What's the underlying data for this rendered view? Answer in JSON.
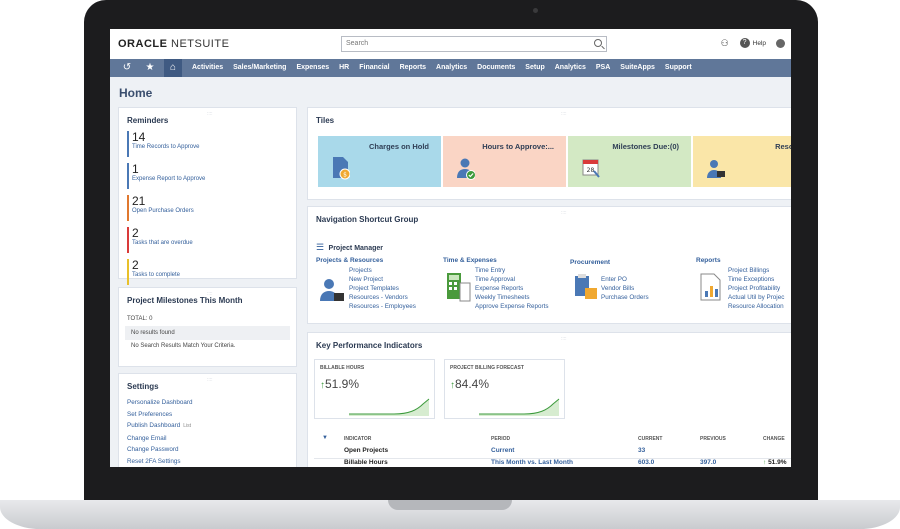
{
  "app": {
    "logo_main": "ORACLE",
    "logo_sub": "NETSUITE",
    "search_placeholder": "Search",
    "help_label": "Help"
  },
  "nav": {
    "items": [
      "Activities",
      "Sales/Marketing",
      "Expenses",
      "HR",
      "Financial",
      "Reports",
      "Analytics",
      "Documents",
      "Setup",
      "Analytics",
      "PSA",
      "SuiteApps",
      "Support"
    ]
  },
  "page": {
    "title": "Home"
  },
  "reminders": {
    "title": "Reminders",
    "items": [
      {
        "count": "14",
        "label": "Time Records to Approve",
        "color": "#4a78b5"
      },
      {
        "count": "1",
        "label": "Expense Report to Approve",
        "color": "#4a78b5"
      },
      {
        "count": "21",
        "label": "Open Purchase Orders",
        "color": "#e0782f"
      },
      {
        "count": "2",
        "label": "Tasks that are overdue",
        "color": "#d93a3a"
      },
      {
        "count": "2",
        "label": "Tasks to complete",
        "color": "#e8c02a"
      }
    ]
  },
  "milestones": {
    "title": "Project Milestones This Month",
    "total": "TOTAL: 0",
    "no_results": "No results found",
    "no_match": "No Search Results Match Your Criteria."
  },
  "settings": {
    "title": "Settings",
    "links": [
      "Personalize Dashboard",
      "Set Preferences",
      "Publish Dashboard",
      "Change Email",
      "Change Password",
      "Reset 2FA Settings"
    ],
    "publish_tag": "List"
  },
  "tiles": {
    "title": "Tiles",
    "items": [
      {
        "label": "Charges on Hold",
        "bg": "#a9d9ea",
        "icon": "document-coin-icon"
      },
      {
        "label": "Hours to Approve:...",
        "bg": "#fad5c5",
        "icon": "user-check-icon"
      },
      {
        "label": "Milestones Due:(0)",
        "bg": "#d3e9c4",
        "icon": "calendar-icon"
      },
      {
        "label": "Resou",
        "bg": "#fae6a8",
        "icon": "resource-user-icon"
      }
    ]
  },
  "shortcuts": {
    "title": "Navigation Shortcut Group",
    "manager": "Project Manager",
    "groups": [
      {
        "title": "Projects & Resources",
        "links": [
          "Projects",
          "New Project",
          "Project Templates",
          "Resources - Vendors",
          "Resources - Employees"
        ]
      },
      {
        "title": "Time & Expenses",
        "links": [
          "Time Entry",
          "Time Approval",
          "Expense Reports",
          "Weekly Timesheets",
          "Approve Expense Reports"
        ]
      },
      {
        "title": "Procurement",
        "links": [
          "Enter PO",
          "Vendor Bills",
          "Purchase Orders"
        ]
      },
      {
        "title": "Reports",
        "links": [
          "Project Billings",
          "Time Exceptions",
          "Project Profitability",
          "Actual Util by Projec",
          "Resource Allocation"
        ]
      }
    ]
  },
  "kpi": {
    "title": "Key Performance Indicators",
    "cards": [
      {
        "label": "BILLABLE HOURS",
        "value": "51.9%"
      },
      {
        "label": "PROJECT BILLING FORECAST",
        "value": "84.4%"
      }
    ],
    "headers": [
      "INDICATOR",
      "PERIOD",
      "CURRENT",
      "PREVIOUS",
      "CHANGE"
    ],
    "rows": [
      {
        "indicator": "Open Projects",
        "period": "Current",
        "current": "33",
        "previous": "",
        "change": ""
      },
      {
        "indicator": "Billable Hours",
        "period": "This Month vs. Last Month",
        "current": "603.0",
        "previous": "397.0",
        "change": "51.9%"
      }
    ]
  }
}
